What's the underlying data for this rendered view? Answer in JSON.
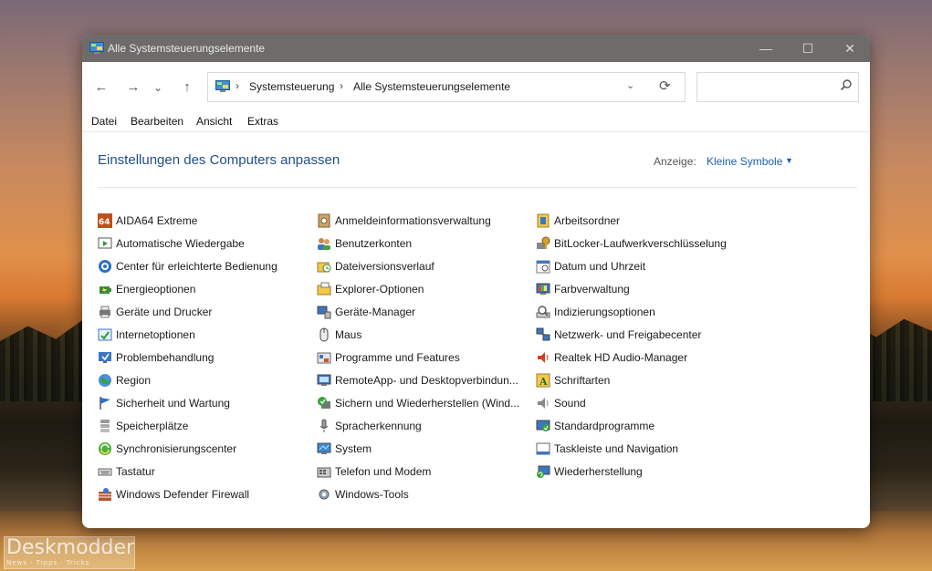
{
  "window": {
    "title": "Alle Systemsteuerungselemente",
    "minimize_glyph": "—",
    "maximize_glyph": "☐",
    "close_glyph": "✕"
  },
  "nav": {
    "back_glyph": "←",
    "forward_glyph": "→",
    "recent_glyph": "⌄",
    "up_glyph": "↑",
    "breadcrumb": [
      "Systemsteuerung",
      "Alle Systemsteuerungselemente"
    ],
    "breadcrumb_sep": "›",
    "dropdown_glyph": "⌄",
    "refresh_glyph": "⟳",
    "search_value": "",
    "search_placeholder": ""
  },
  "menu": [
    "Datei",
    "Bearbeiten",
    "Ansicht",
    "Extras"
  ],
  "content": {
    "heading": "Einstellungen des Computers anpassen",
    "view_label": "Anzeige:",
    "view_value": "Kleine Symbole",
    "view_caret": "▼"
  },
  "columns": [
    [
      {
        "label": "AIDA64 Extreme",
        "icon": "aida64-icon"
      },
      {
        "label": "Automatische Wiedergabe",
        "icon": "autoplay-icon"
      },
      {
        "label": "Center für erleichterte Bedienung",
        "icon": "ease-of-access-icon"
      },
      {
        "label": "Energieoptionen",
        "icon": "power-options-icon"
      },
      {
        "label": "Geräte und Drucker",
        "icon": "devices-printers-icon"
      },
      {
        "label": "Internetoptionen",
        "icon": "internet-options-icon"
      },
      {
        "label": "Problembehandlung",
        "icon": "troubleshooting-icon"
      },
      {
        "label": "Region",
        "icon": "region-icon"
      },
      {
        "label": "Sicherheit und Wartung",
        "icon": "security-maintenance-icon"
      },
      {
        "label": "Speicherplätze",
        "icon": "storage-spaces-icon"
      },
      {
        "label": "Synchronisierungscenter",
        "icon": "sync-center-icon"
      },
      {
        "label": "Tastatur",
        "icon": "keyboard-icon"
      },
      {
        "label": "Windows Defender Firewall",
        "icon": "firewall-icon"
      }
    ],
    [
      {
        "label": "Anmeldeinformationsverwaltung",
        "icon": "credential-manager-icon"
      },
      {
        "label": "Benutzerkonten",
        "icon": "user-accounts-icon"
      },
      {
        "label": "Dateiversionsverlauf",
        "icon": "file-history-icon"
      },
      {
        "label": "Explorer-Optionen",
        "icon": "explorer-options-icon"
      },
      {
        "label": "Geräte-Manager",
        "icon": "device-manager-icon"
      },
      {
        "label": "Maus",
        "icon": "mouse-icon"
      },
      {
        "label": "Programme und Features",
        "icon": "programs-features-icon"
      },
      {
        "label": "RemoteApp- und Desktopverbindun...",
        "icon": "remoteapp-icon"
      },
      {
        "label": "Sichern und Wiederherstellen (Wind...",
        "icon": "backup-restore-icon"
      },
      {
        "label": "Spracherkennung",
        "icon": "speech-recognition-icon"
      },
      {
        "label": "System",
        "icon": "system-icon"
      },
      {
        "label": "Telefon und Modem",
        "icon": "phone-modem-icon"
      },
      {
        "label": "Windows-Tools",
        "icon": "windows-tools-icon"
      }
    ],
    [
      {
        "label": "Arbeitsordner",
        "icon": "work-folders-icon"
      },
      {
        "label": "BitLocker-Laufwerkverschlüsselung",
        "icon": "bitlocker-icon"
      },
      {
        "label": "Datum und Uhrzeit",
        "icon": "date-time-icon"
      },
      {
        "label": "Farbverwaltung",
        "icon": "color-management-icon"
      },
      {
        "label": "Indizierungsoptionen",
        "icon": "indexing-options-icon"
      },
      {
        "label": "Netzwerk- und Freigabecenter",
        "icon": "network-sharing-icon"
      },
      {
        "label": "Realtek HD Audio-Manager",
        "icon": "realtek-audio-icon"
      },
      {
        "label": "Schriftarten",
        "icon": "fonts-icon"
      },
      {
        "label": "Sound",
        "icon": "sound-icon"
      },
      {
        "label": "Standardprogramme",
        "icon": "default-programs-icon"
      },
      {
        "label": "Taskleiste und Navigation",
        "icon": "taskbar-navigation-icon"
      },
      {
        "label": "Wiederherstellung",
        "icon": "recovery-icon"
      }
    ]
  ],
  "watermark": {
    "text": "Deskmodder.de",
    "sub": "News · Tipps · Tricks"
  }
}
